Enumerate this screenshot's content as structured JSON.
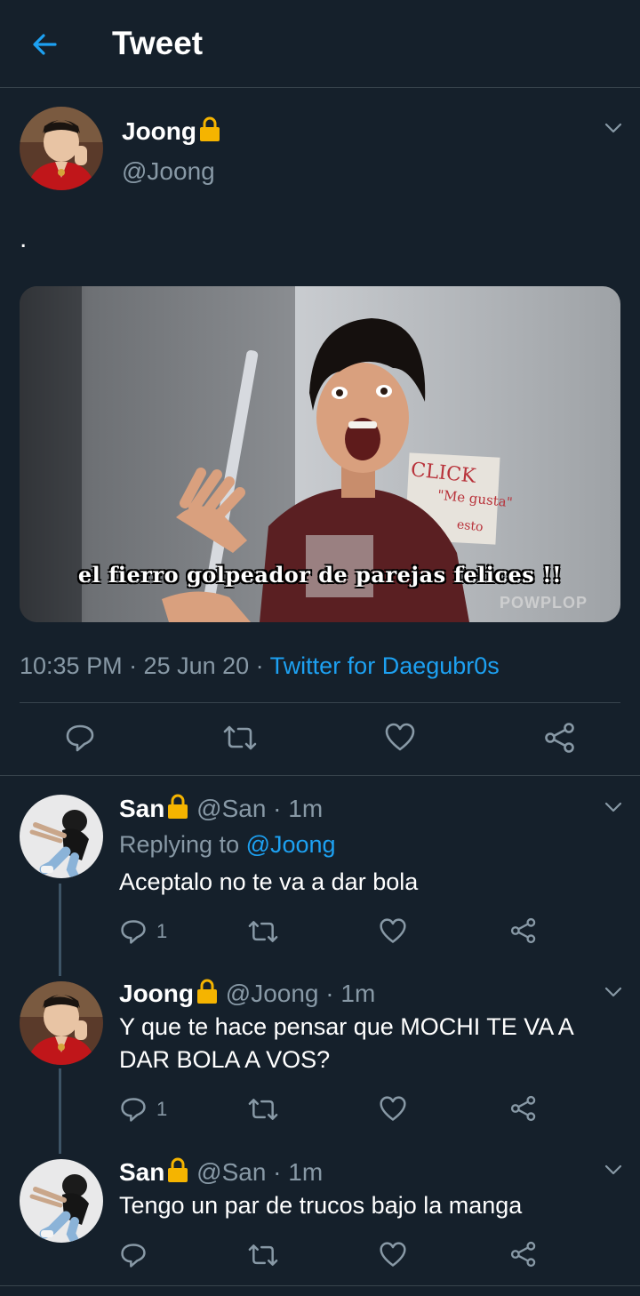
{
  "header": {
    "title": "Tweet"
  },
  "main_tweet": {
    "display_name": "Joong",
    "handle": "@Joong",
    "text": ".",
    "media_caption": "el fierro golpeador de parejas felices !!",
    "media_sign": "CLICK",
    "media_sign_2": "\"Me gusta\"",
    "media_sign_3": "esto",
    "media_watermark": "POWPLOP",
    "timestamp": "10:35 PM · 25 Jun 20 · ",
    "source": "Twitter for Daegubr0s"
  },
  "replies": [
    {
      "display_name": "San",
      "handle_time": "@San · 1m",
      "replying_label": "Replying to ",
      "replying_to": "@Joong",
      "text": "Aceptalo no te va a dar bola",
      "reply_count": "1"
    },
    {
      "display_name": "Joong",
      "handle_time": "@Joong · 1m",
      "text_line1": "Y que te hace pensar que MOCHI TE VA A",
      "text_line2": "DAR BOLA A VOS?",
      "reply_count": "1"
    },
    {
      "display_name": "San",
      "handle_time": "@San · 1m",
      "text": "Tengo un par de trucos bajo la manga",
      "reply_count": ""
    }
  ],
  "colors": {
    "background": "#15202b",
    "accent": "#1da1f2",
    "muted": "#8899a6",
    "divider": "#38444d",
    "lock": "#f5b400"
  }
}
